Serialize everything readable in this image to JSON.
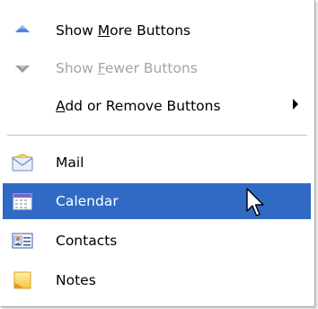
{
  "menu": {
    "items": [
      {
        "label_pre": "Show ",
        "label_u": "M",
        "label_post": "ore Buttons",
        "icon": "up-arrow-icon",
        "disabled": false
      },
      {
        "label_pre": "Show ",
        "label_u": "F",
        "label_post": "ewer Buttons",
        "icon": "down-arrow-icon",
        "disabled": true
      },
      {
        "label_pre": "",
        "label_u": "A",
        "label_post": "dd or Remove Buttons",
        "icon": "",
        "disabled": false
      }
    ],
    "nav": [
      {
        "label": "Mail",
        "icon": "mail-icon"
      },
      {
        "label": "Calendar",
        "icon": "calendar-icon",
        "selected": true
      },
      {
        "label": "Contacts",
        "icon": "contacts-icon"
      },
      {
        "label": "Notes",
        "icon": "notes-icon"
      }
    ]
  },
  "colors": {
    "highlight": "#316ac5",
    "disabled_text": "#a4a4a4",
    "up_arrow": "#3a73d9",
    "down_arrow": "#9a9a9a"
  }
}
